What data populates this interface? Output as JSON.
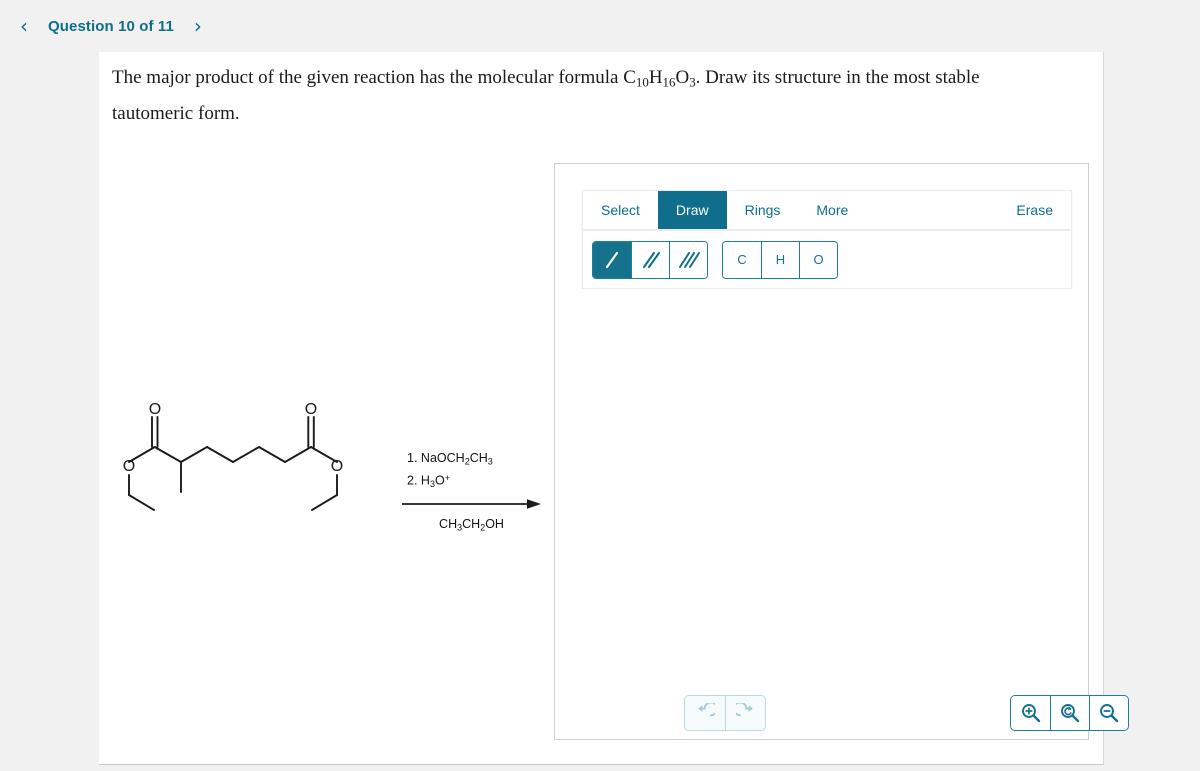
{
  "header": {
    "prev_icon": "chevron-left-icon",
    "prev_label": "‹",
    "next_label": "›",
    "question_label": "Question 10 of 11",
    "accent_color": "#0e6e8c"
  },
  "question": {
    "text_part1": "The major product of the given reaction has the molecular formula C",
    "sub1": "10",
    "elem2": "H",
    "sub2": "16",
    "elem3": "O",
    "sub3": "3",
    "text_part2": ". Draw its structure in the most stable tautomeric form."
  },
  "reaction": {
    "reactant_name": "diethyl 2-methylheptanedioate",
    "reactant_labels": {
      "carbonyl_o_left": "O",
      "ester_o_left": "O",
      "carbonyl_o_right": "O",
      "ester_o_right": "O"
    },
    "conditions_above_line1_num": "1.",
    "conditions_above_line1": "NaOCH",
    "conditions_above_line1_sub": "2",
    "conditions_above_line1_tail": "CH",
    "conditions_above_line1_sub2": "3",
    "conditions_above_line2_num": "2.",
    "conditions_above_line2": "H",
    "conditions_above_line2_sub": "3",
    "conditions_above_line2_tail": "O",
    "conditions_above_line2_sup": "+",
    "conditions_below": "CH",
    "conditions_below_sub1": "3",
    "conditions_below_mid": "CH",
    "conditions_below_sub2": "2",
    "conditions_below_tail": "OH"
  },
  "drawing_tool": {
    "tabs": [
      {
        "label": "Select",
        "active": false
      },
      {
        "label": "Draw",
        "active": true
      },
      {
        "label": "Rings",
        "active": false
      },
      {
        "label": "More",
        "active": false
      }
    ],
    "erase_label": "Erase",
    "bond_tools": [
      {
        "name": "single-bond-tool",
        "active": true
      },
      {
        "name": "double-bond-tool",
        "active": false
      },
      {
        "name": "triple-bond-tool",
        "active": false
      }
    ],
    "element_tools": [
      {
        "label": "C",
        "name": "element-carbon-button"
      },
      {
        "label": "H",
        "name": "element-hydrogen-button"
      },
      {
        "label": "O",
        "name": "element-oxygen-button"
      }
    ],
    "history_tools": [
      {
        "name": "undo-button",
        "enabled": false
      },
      {
        "name": "redo-button",
        "enabled": false
      }
    ],
    "zoom_tools": [
      {
        "name": "zoom-in-button"
      },
      {
        "name": "zoom-reset-button"
      },
      {
        "name": "zoom-out-button"
      }
    ],
    "accent_color": "#0e6e8c",
    "accent_border": "#1b7e9b",
    "disabled_color": "#a8cbd7"
  }
}
